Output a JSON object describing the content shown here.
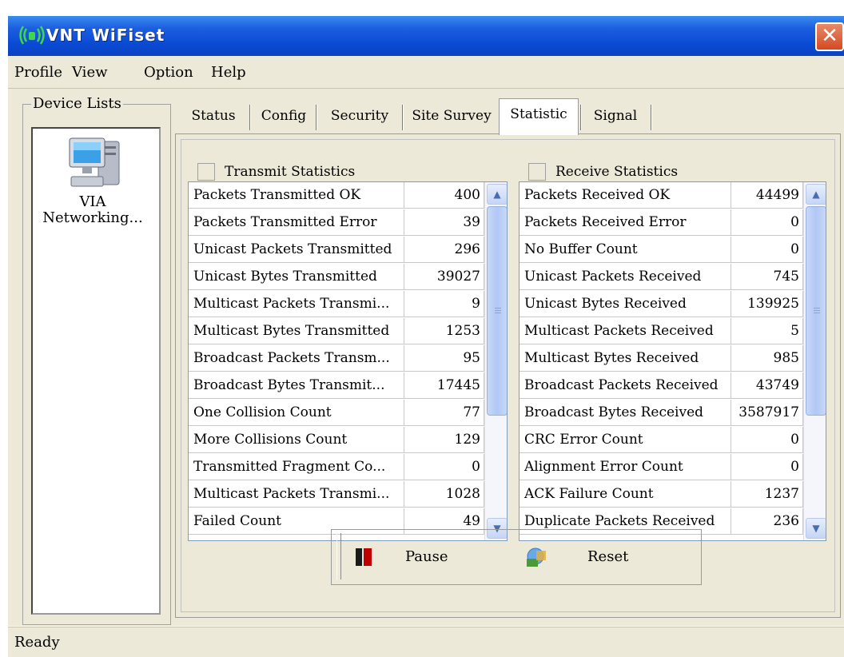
{
  "window": {
    "title": "VNT WiFiset"
  },
  "menu": [
    "Profile",
    "View",
    "Option",
    "Help"
  ],
  "device_lists": {
    "legend": "Device Lists",
    "device_line1": "VIA",
    "device_line2": "Networking..."
  },
  "tabs": [
    "Status",
    "Config",
    "Security",
    "Site Survey",
    "Statistic",
    "Signal"
  ],
  "active_tab": "Statistic",
  "transmit": {
    "title": "Transmit Statistics",
    "rows": [
      {
        "name": "Packets Transmitted OK",
        "value": "400"
      },
      {
        "name": "Packets Transmitted Error",
        "value": "39"
      },
      {
        "name": "Unicast Packets Transmitted",
        "value": "296"
      },
      {
        "name": "Unicast Bytes Transmitted",
        "value": "39027"
      },
      {
        "name": "Multicast Packets Transmi...",
        "value": "9"
      },
      {
        "name": "Multicast Bytes Transmitted",
        "value": "1253"
      },
      {
        "name": "Broadcast Packets Transm...",
        "value": "95"
      },
      {
        "name": "Broadcast Bytes Transmit...",
        "value": "17445"
      },
      {
        "name": "One Collision Count",
        "value": "77"
      },
      {
        "name": "More Collisions Count",
        "value": "129"
      },
      {
        "name": "Transmitted Fragment Co...",
        "value": "0"
      },
      {
        "name": "Multicast Packets Transmi...",
        "value": "1028"
      },
      {
        "name": "Failed Count",
        "value": "49"
      }
    ]
  },
  "receive": {
    "title": "Receive Statistics",
    "rows": [
      {
        "name": "Packets Received OK",
        "value": "44499"
      },
      {
        "name": "Packets Received Error",
        "value": "0"
      },
      {
        "name": "No Buffer Count",
        "value": "0"
      },
      {
        "name": "Unicast Packets Received",
        "value": "745"
      },
      {
        "name": "Unicast Bytes Received",
        "value": "139925"
      },
      {
        "name": "Multicast Packets Received",
        "value": "5"
      },
      {
        "name": "Multicast Bytes Received",
        "value": "985"
      },
      {
        "name": "Broadcast Packets Received",
        "value": "43749"
      },
      {
        "name": "Broadcast Bytes Received",
        "value": "3587917"
      },
      {
        "name": "CRC Error Count",
        "value": "0"
      },
      {
        "name": "Alignment Error Count",
        "value": "0"
      },
      {
        "name": "ACK Failure Count",
        "value": "1237"
      },
      {
        "name": "Duplicate Packets Received",
        "value": "236"
      }
    ]
  },
  "buttons": {
    "pause": "Pause",
    "reset": "Reset"
  },
  "status": "Ready",
  "colors": {
    "titlebar": "#0a4ad4",
    "close": "#d34a22",
    "face": "#ece9d8",
    "pause_icon": "#c00000"
  },
  "icons": [
    "wifi-logo-icon",
    "close-icon",
    "computer-icon",
    "pause-icon",
    "reset-icon",
    "scroll-up-icon",
    "scroll-down-icon"
  ]
}
